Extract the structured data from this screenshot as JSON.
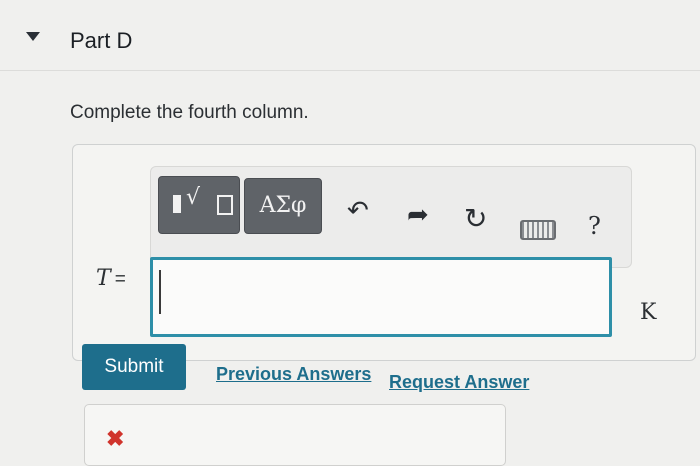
{
  "part": {
    "title": "Part D"
  },
  "question": {
    "instruction": "Complete the fourth column."
  },
  "toolbar": {
    "templates_icon": "math-templates-icon",
    "greek_label": "ΑΣφ",
    "undo_icon": "undo-icon",
    "redo_icon": "redo-icon",
    "reset_icon": "reset-icon",
    "keyboard_icon": "keyboard-icon",
    "help_label": "?"
  },
  "answer": {
    "variable": "T",
    "equals": "=",
    "value": "",
    "unit": "K"
  },
  "actions": {
    "submit_label": "Submit",
    "previous_answers_label": "Previous Answers",
    "request_answer_label": "Request Answer"
  },
  "feedback": {
    "status_icon": "incorrect-x-icon"
  },
  "colors": {
    "accent": "#1e6e8c",
    "input_focus": "#2e8fa8",
    "incorrect": "#d0342c"
  }
}
